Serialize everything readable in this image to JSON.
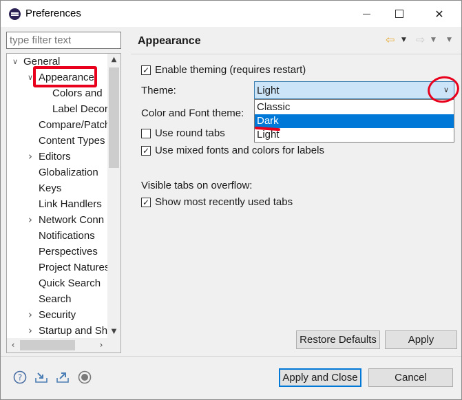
{
  "window": {
    "title": "Preferences",
    "minimize_icon": "minimize-icon",
    "maximize_icon": "maximize-icon",
    "close_glyph": "✕"
  },
  "filter": {
    "placeholder": "type filter text"
  },
  "tree": {
    "items": [
      {
        "label": "General",
        "level": 0,
        "expander": "expanded"
      },
      {
        "label": "Appearance",
        "level": 1,
        "expander": "expanded",
        "selected": true
      },
      {
        "label": "Colors and",
        "level": 2,
        "expander": "none"
      },
      {
        "label": "Label Decor",
        "level": 2,
        "expander": "none"
      },
      {
        "label": "Compare/Patch",
        "level": 1,
        "expander": "none"
      },
      {
        "label": "Content Types",
        "level": 1,
        "expander": "none"
      },
      {
        "label": "Editors",
        "level": 1,
        "expander": "collapsed"
      },
      {
        "label": "Globalization",
        "level": 1,
        "expander": "none"
      },
      {
        "label": "Keys",
        "level": 1,
        "expander": "none"
      },
      {
        "label": "Link Handlers",
        "level": 1,
        "expander": "none"
      },
      {
        "label": "Network Conn",
        "level": 1,
        "expander": "collapsed"
      },
      {
        "label": "Notifications",
        "level": 1,
        "expander": "none"
      },
      {
        "label": "Perspectives",
        "level": 1,
        "expander": "none"
      },
      {
        "label": "Project Natures",
        "level": 1,
        "expander": "none"
      },
      {
        "label": "Quick Search",
        "level": 1,
        "expander": "none"
      },
      {
        "label": "Search",
        "level": 1,
        "expander": "none"
      },
      {
        "label": "Security",
        "level": 1,
        "expander": "collapsed"
      },
      {
        "label": "Startup and Sh",
        "level": 1,
        "expander": "collapsed"
      }
    ]
  },
  "page": {
    "title": "Appearance",
    "enable_theming": {
      "label": "Enable theming (requires restart)",
      "checked": true
    },
    "theme_label": "Theme:",
    "theme_value": "Light",
    "theme_options": [
      {
        "label": "Classic",
        "selected": false
      },
      {
        "label": "Dark",
        "selected": true
      },
      {
        "label": "Light",
        "selected": false
      }
    ],
    "color_font_label": "Color and Font theme:",
    "round_tabs": {
      "label": "Use round tabs",
      "checked": false
    },
    "mixed_fonts": {
      "label": "Use mixed fonts and colors for labels",
      "checked": true
    },
    "overflow_label": "Visible tabs on overflow:",
    "mru_tabs": {
      "label": "Show most recently used tabs",
      "checked": true
    },
    "restore_defaults": "Restore Defaults",
    "apply": "Apply"
  },
  "footer": {
    "apply_and_close": "Apply and Close",
    "cancel": "Cancel",
    "icons": [
      "help-icon",
      "import-icon",
      "export-icon",
      "record-icon"
    ]
  },
  "colors": {
    "accent": "#0078d7",
    "annotation": "#e8001c",
    "combo_bg": "#cce4f7"
  }
}
